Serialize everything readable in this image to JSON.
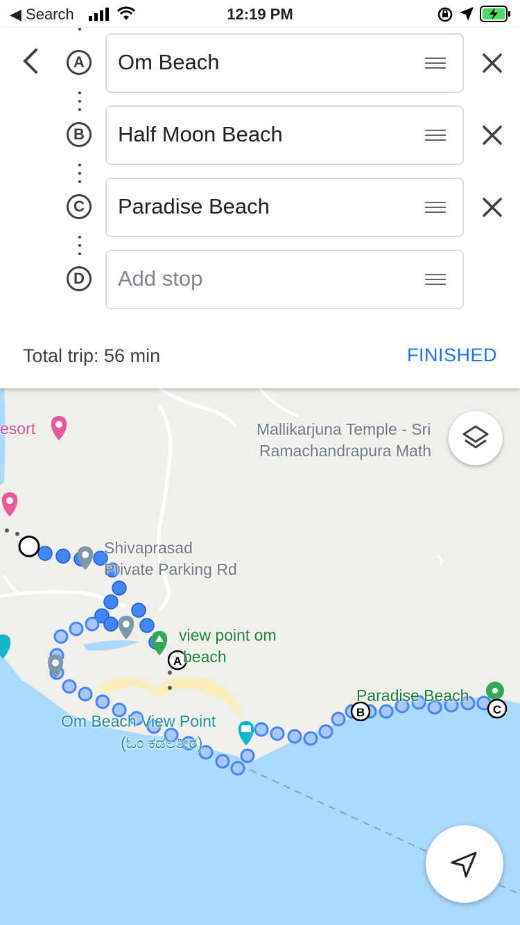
{
  "status_bar": {
    "back_label": "◀ Search",
    "time": "12:19 PM"
  },
  "directions": {
    "stops": [
      {
        "letter": "A",
        "value": "Om Beach",
        "placeholder": ""
      },
      {
        "letter": "B",
        "value": "Half Moon Beach",
        "placeholder": ""
      },
      {
        "letter": "C",
        "value": "Paradise Beach",
        "placeholder": ""
      },
      {
        "letter": "D",
        "value": "",
        "placeholder": "Add stop"
      }
    ],
    "total_trip": "Total trip: 56 min",
    "finished_label": "FINISHED"
  },
  "map": {
    "labels": {
      "resort": "esort",
      "temple_line1": "Mallikarjuna Temple - Sri",
      "temple_line2": "Ramachandrapura Math",
      "parking_line1": "Shivaprasad",
      "parking_line2": "Private Parking Rd",
      "viewpoint_line1": "view point om",
      "viewpoint_line2": "beach",
      "ombeach_line1": "Om Beach View Point",
      "ombeach_line2": "(ಓಂ ಕಡಲತೀರ)",
      "paradise": "Paradise Beach"
    },
    "markers": [
      "A",
      "B",
      "C"
    ]
  },
  "colors": {
    "accent": "#1a73e8",
    "water": "#aadaff",
    "route": "#4285f4"
  },
  "icons": [
    "signal-icon",
    "wifi-icon",
    "lock-rotation-icon",
    "location-arrow-icon",
    "battery-icon",
    "back-arrow-icon",
    "drag-handle-icon",
    "close-icon",
    "layers-icon",
    "navigate-icon"
  ]
}
